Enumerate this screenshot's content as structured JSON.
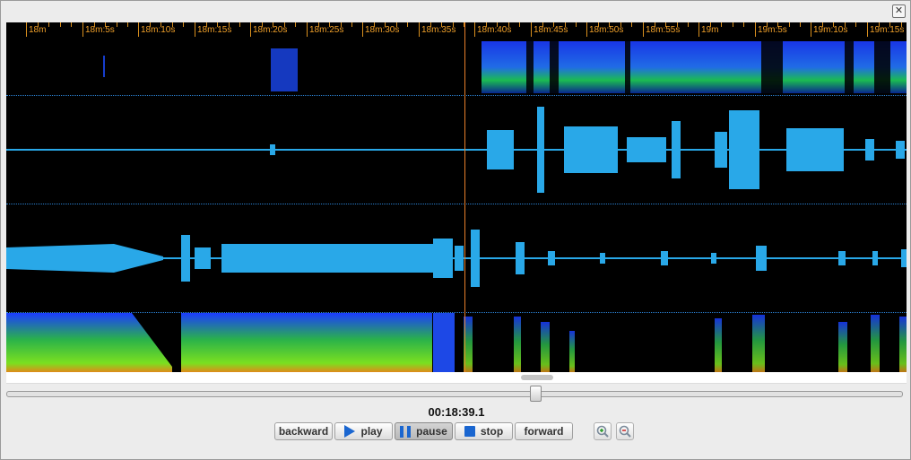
{
  "window": {
    "close_label": "✕"
  },
  "timeline": {
    "ticks": [
      "18m",
      "18m:5s",
      "18m:10s",
      "18m:15s",
      "18m:20s",
      "18m:25s",
      "18m:30s",
      "18m:35s",
      "18m:40s",
      "18m:45s",
      "18m:50s",
      "18m:55s",
      "19m",
      "19m:5s",
      "19m:10s",
      "19m:15s"
    ]
  },
  "tracks": [
    {
      "type": "spectrogram",
      "name": "top-spectrogram"
    },
    {
      "type": "waveform",
      "name": "waveform-1"
    },
    {
      "type": "waveform",
      "name": "waveform-2"
    },
    {
      "type": "spectrogram",
      "name": "bottom-spectrogram"
    }
  ],
  "playback": {
    "current_time": "00:18:39.1",
    "position_fraction": 0.594
  },
  "controls": {
    "backward_label": "backward",
    "play_label": "play",
    "pause_label": "pause",
    "stop_label": "stop",
    "forward_label": "forward"
  },
  "colors": {
    "waveform": "#29a8e8",
    "ruler": "#f0a02a",
    "cursor": "#e8802a",
    "button_icon": "#1a66d0"
  },
  "icons": [
    "play-icon",
    "pause-icon",
    "stop-icon",
    "zoom-in-icon",
    "zoom-out-icon",
    "close-icon"
  ]
}
